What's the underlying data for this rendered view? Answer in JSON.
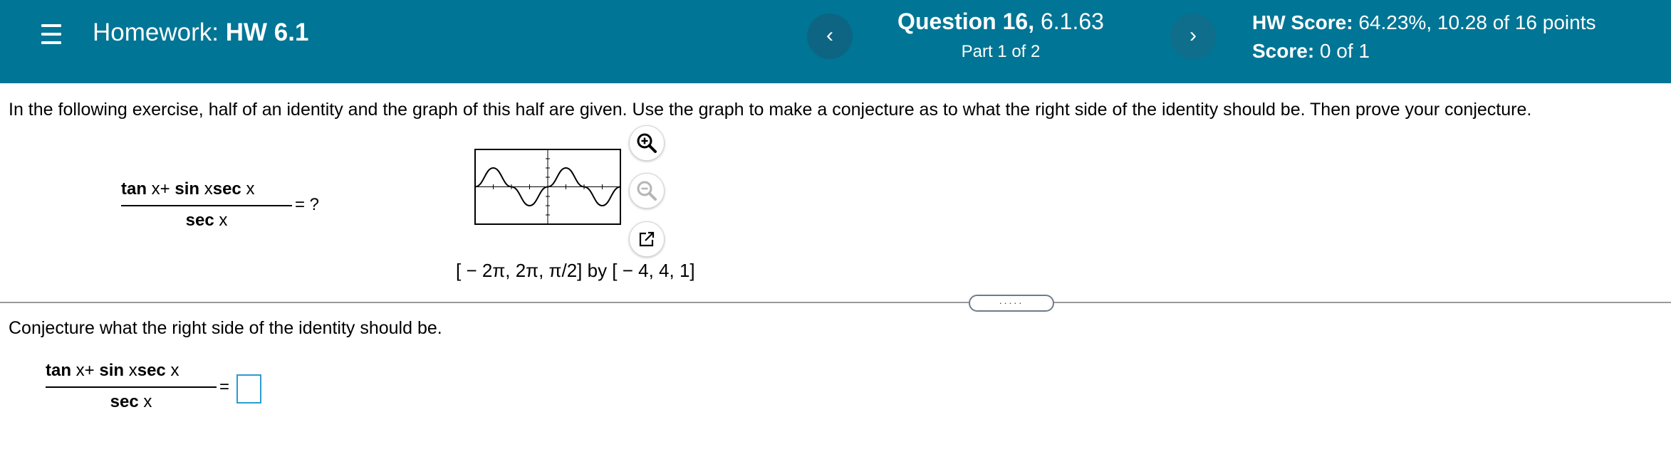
{
  "header": {
    "homework_prefix": "Homework: ",
    "homework_name": "HW 6.1",
    "question_label": "Question 16,",
    "question_ref": " 6.1.63",
    "part": "Part 1 of 2",
    "hw_score_label": "HW Score:",
    "hw_score_value": " 64.23%, 10.28 of 16 points",
    "score_label": "Score:",
    "score_value": " 0 of 1",
    "prev_glyph": "‹",
    "next_glyph": "›"
  },
  "problem": {
    "instructions": "In the following exercise, half of an identity and the graph of this half are given. Use the graph to make a conjecture as to what the right side of the identity should be. Then prove your conjecture.",
    "numerator": {
      "tan": "tan",
      "x1": "x",
      "plus": "+",
      "sin": "sin",
      "x2": "x",
      "sec": "sec",
      "x3": "x"
    },
    "denominator": {
      "sec": "sec",
      "x": "x"
    },
    "rhs": "= ?",
    "window": "[ − 2π, 2π, π/2] by [ − 4, 4, 1]",
    "icons": [
      "zoom-in-icon",
      "zoom-out-icon",
      "open-external-icon"
    ]
  },
  "divider": {
    "handle_dots": "....."
  },
  "part1": {
    "prompt": "Conjecture what the right side of the identity should be.",
    "numerator": {
      "tan": "tan",
      "x1": "x",
      "plus": "+",
      "sin": "sin",
      "x2": "x",
      "sec": "sec",
      "x3": "x"
    },
    "denominator": {
      "sec": "sec",
      "x": "x"
    },
    "equals": "=",
    "answer_value": ""
  },
  "colors": {
    "header_bg": "#007595",
    "answer_border": "#2a9bd1"
  }
}
